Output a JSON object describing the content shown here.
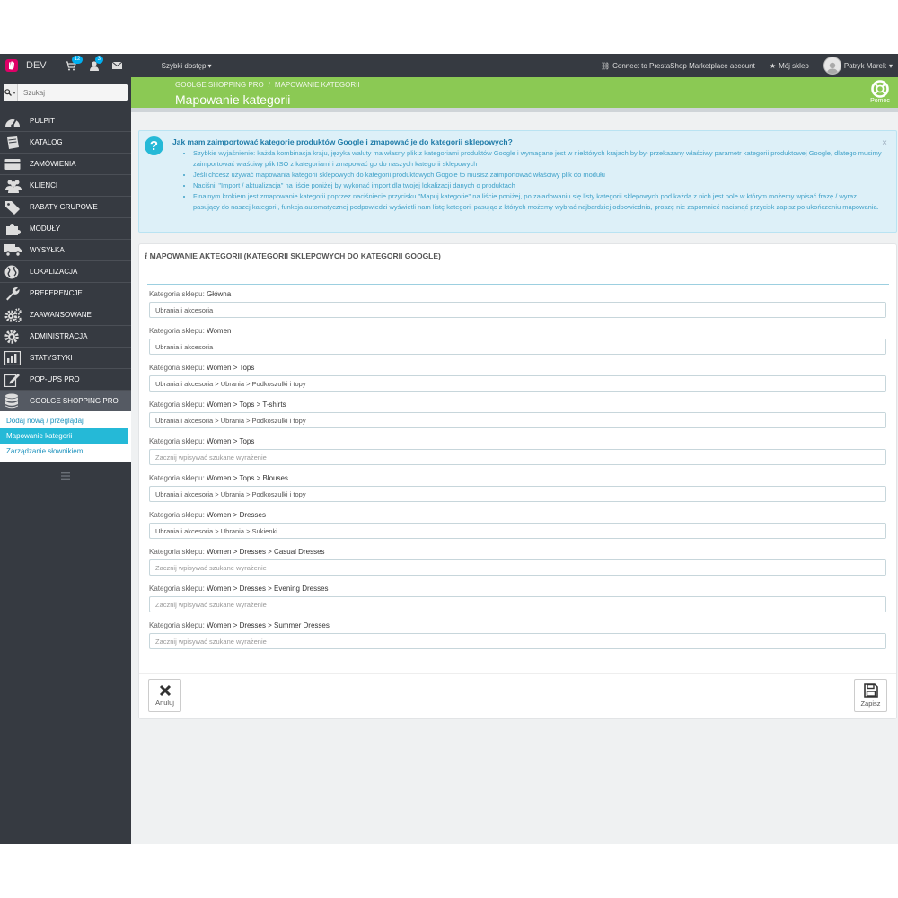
{
  "topbar": {
    "brand": "DEV",
    "cart_count": "12",
    "users_count": "3",
    "quick_access": "Szybki dostęp",
    "marketplace": "Connect to PrestaShop Marketplace account",
    "my_shop": "Mój sklep",
    "user_name": "Patryk Marek"
  },
  "search": {
    "placeholder": "Szukaj"
  },
  "sidebar": {
    "items": [
      {
        "label": "PULPIT",
        "icon": "dashboard-icon"
      },
      {
        "label": "KATALOG",
        "icon": "book-icon"
      },
      {
        "label": "ZAMÓWIENIA",
        "icon": "credit-card-icon"
      },
      {
        "label": "KLIENCI",
        "icon": "users-icon"
      },
      {
        "label": "RABATY GRUPOWE",
        "icon": "tags-icon"
      },
      {
        "label": "MODUŁY",
        "icon": "puzzle-icon"
      },
      {
        "label": "WYSYŁKA",
        "icon": "truck-icon"
      },
      {
        "label": "LOKALIZACJA",
        "icon": "globe-icon"
      },
      {
        "label": "PREFERENCJE",
        "icon": "wrench-icon"
      },
      {
        "label": "ZAAWANSOWANE",
        "icon": "cogs-icon"
      },
      {
        "label": "ADMINISTRACJA",
        "icon": "cog-icon"
      },
      {
        "label": "STATYSTYKI",
        "icon": "bar-chart-icon"
      },
      {
        "label": "POP-UPS PRO",
        "icon": "edit-icon"
      },
      {
        "label": "GOOLGE SHOPPING PRO",
        "icon": "database-icon"
      }
    ],
    "submenu": [
      "Dodaj nową / przeglądaj",
      "Mapowanie kategorii",
      "Zarządzanie słownikiem"
    ]
  },
  "header": {
    "breadcrumb": [
      "GOOLGE SHOPPING PRO",
      "MAPOWANIE KATEGORII"
    ],
    "title": "Mapowanie kategorii",
    "help": "Pomoc"
  },
  "alert": {
    "title": "Jak mam zaimportować kategorie produktów Google i zmapować je do kategorii sklepowych?",
    "items": [
      "Szybkie wyjaśnienie: każda kombinacja kraju, języka waluty ma własny plik z kategoriami produktów Google i wymagane jest w niektórych krajach by był przekazany właściwy parametr kategorii produktowej Google, dlatego musimy zaimportować właściwy plik ISO z kategoriami i zmapować go do naszych kategorii sklepowych",
      "Jeśli chcesz używać mapowania kategorii sklepowych do kategorii produktowych Gogole to musisz zaimportować właściwy plik do modułu",
      "Naciśnij \"Import / aktualizacja\" na liście poniżej by wykonać import dla twojej lokalizacji danych o produktach",
      "Finalnym krokiem jest zmapowanie kategorii poprzez naciśniecie przycisku \"Mapuj kategorie\" na liście poniżej, po załadowaniu się listy kategorii sklepowych pod każdą z nich jest pole w którym możemy wpisać frazę / wyraz pasujący do naszej kategorii, funkcja automatycznej podpowiedzi wyświetli nam listę kategorii pasując z których możemy wybrać najbardziej odpowiednia, proszę nie zapomnieć nacisnąć przycisk zapisz po ukończeniu mapowania."
    ]
  },
  "panel": {
    "title": "MAPOWANIE AKTEGORII (KATEGORII SKLEPOWYCH DO KATEGORII GOOGLE)",
    "label_prefix": "Kategoria sklepu:",
    "placeholder": "Zacznij wpisywać szukane wyrażenie",
    "rows": [
      {
        "category": "Główna",
        "value": "Ubrania i akcesoria"
      },
      {
        "category": "Women",
        "value": "Ubrania i akcesoria"
      },
      {
        "category": "Women > Tops",
        "value": "Ubrania i akcesoria > Ubrania > Podkoszulki i topy"
      },
      {
        "category": "Women > Tops > T-shirts",
        "value": "Ubrania i akcesoria > Ubrania > Podkoszulki i topy"
      },
      {
        "category": "Women > Tops",
        "value": ""
      },
      {
        "category": "Women > Tops > Blouses",
        "value": "Ubrania i akcesoria > Ubrania > Podkoszulki i topy"
      },
      {
        "category": "Women > Dresses",
        "value": "Ubrania i akcesoria > Ubrania > Sukienki"
      },
      {
        "category": "Women > Dresses > Casual Dresses",
        "value": ""
      },
      {
        "category": "Women > Dresses > Evening Dresses",
        "value": ""
      },
      {
        "category": "Women > Dresses > Summer Dresses",
        "value": ""
      }
    ],
    "cancel": "Anuluj",
    "save": "Zapisz"
  },
  "colors": {
    "topbar": "#363a41",
    "header_green": "#8bc954",
    "accent_blue": "#25b9d7",
    "alert_bg": "#ddf0f8"
  }
}
